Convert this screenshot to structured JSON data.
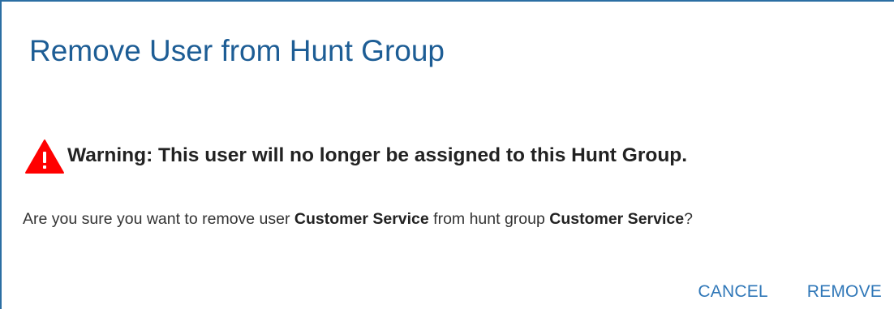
{
  "dialog": {
    "title": "Remove User from Hunt Group",
    "warning": {
      "icon": "warning-triangle-icon",
      "icon_color": "#ff0000",
      "text": "Warning: This user will no longer be assigned to this Hunt Group."
    },
    "confirmation": {
      "prefix": "Are you sure you want to remove user ",
      "user_name": "Customer Service",
      "middle": " from hunt group ",
      "group_name": "Customer Service",
      "suffix": "?"
    },
    "actions": {
      "cancel_label": "CANCEL",
      "remove_label": "REMOVE"
    },
    "colors": {
      "title": "#1d5d95",
      "accent": "#2f77b8",
      "border": "#2b6ea3"
    }
  }
}
